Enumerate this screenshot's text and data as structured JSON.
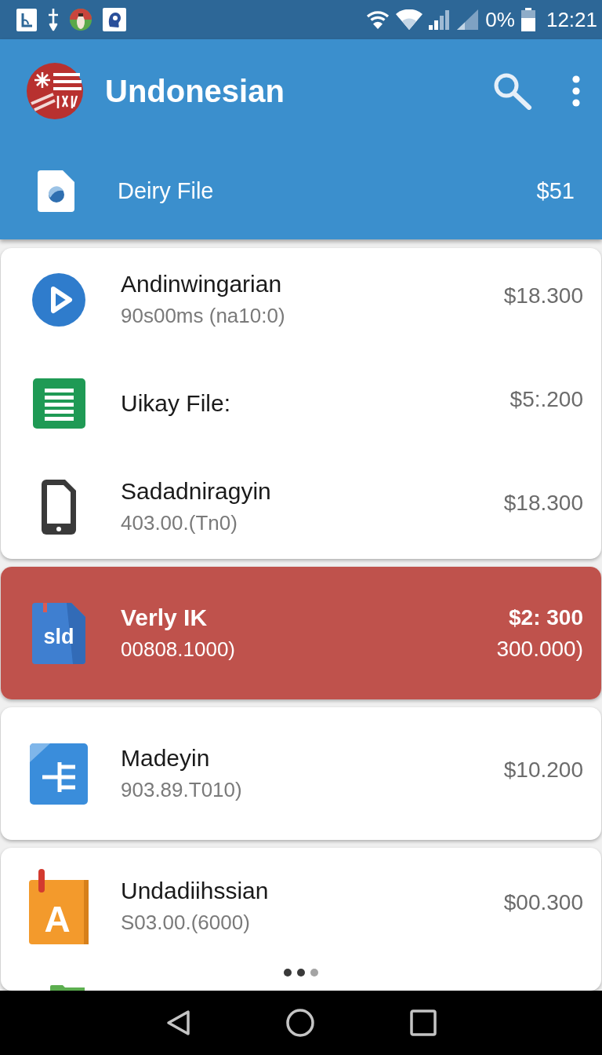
{
  "status_bar": {
    "battery": "0%",
    "time": "12:21"
  },
  "app_bar": {
    "title": "Undonesian",
    "file_row": {
      "label": "Deiry File",
      "amount": "$51"
    }
  },
  "groups": [
    {
      "items": [
        {
          "kind": "play",
          "title": "Andinwingarian",
          "subtitle": "90s00ms (na10:0)",
          "amount": "$18.300",
          "selected": false
        },
        {
          "kind": "sheet",
          "title": "Uikay File:",
          "amount": "$5:.200",
          "selected": false
        },
        {
          "kind": "phone",
          "title": "Sadadniragyin",
          "subtitle": "403.00.(Tn0)",
          "amount": "$18.300",
          "selected": false
        }
      ]
    },
    {
      "items": [
        {
          "kind": "slides",
          "icon_label": "sld",
          "title": "Verly IK",
          "subtitle": "00808.1000)",
          "amount": "$2: 300",
          "amount_2": "300.000)",
          "selected": true
        }
      ]
    },
    {
      "items": [
        {
          "kind": "docs",
          "title": "Madeyin",
          "subtitle": "903.89.T010)",
          "amount": "$10.200",
          "selected": false
        }
      ]
    },
    {
      "items": [
        {
          "kind": "book",
          "icon_label": "A",
          "title": "Undadiihssian",
          "subtitle": "S03.00.(6000)",
          "amount": "$00.300",
          "selected": false
        }
      ],
      "pager": [
        {
          "on": true
        },
        {
          "on": true
        },
        {
          "on": false
        }
      ],
      "partial_item": {
        "kind": "folder"
      }
    }
  ]
}
